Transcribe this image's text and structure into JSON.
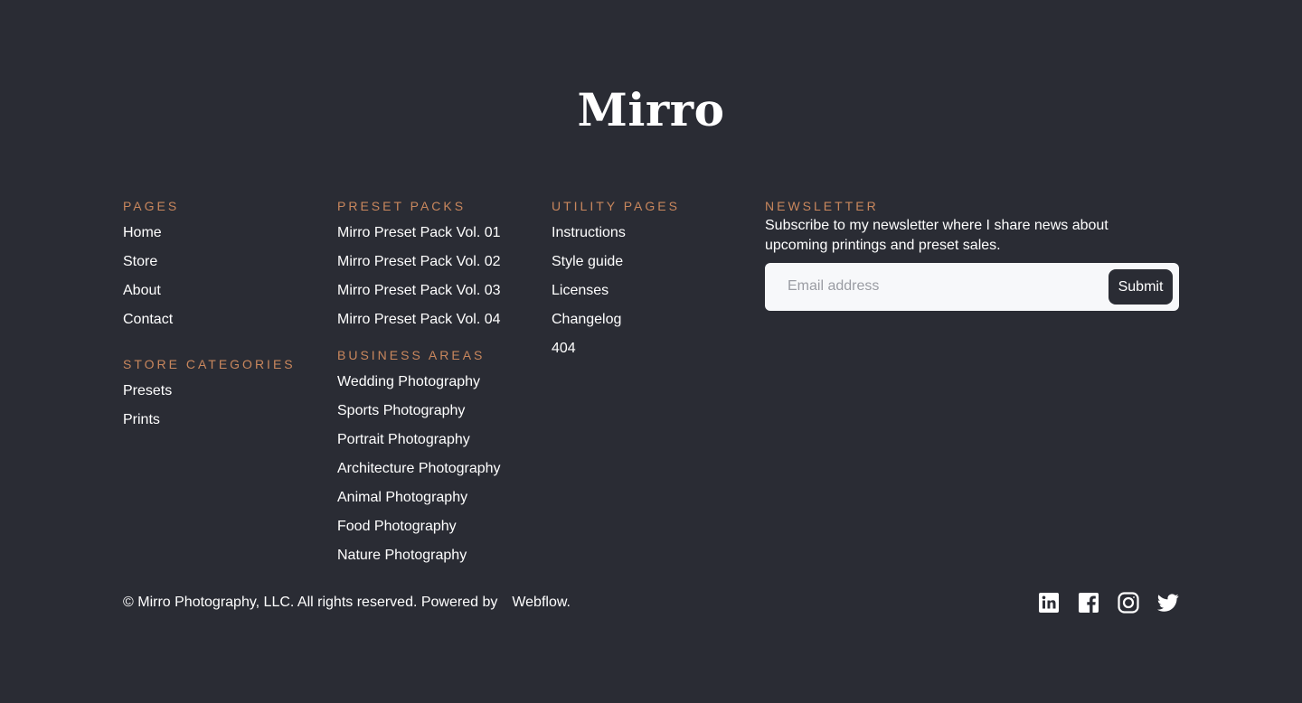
{
  "logo": {
    "text": "Mirro"
  },
  "columns": {
    "pages": {
      "heading": "Pages",
      "items": [
        "Home",
        "Store",
        "About",
        "Contact"
      ]
    },
    "store_categories": {
      "heading": "Store Categories",
      "items": [
        "Presets",
        "Prints"
      ]
    },
    "preset_packs": {
      "heading": "Preset Packs",
      "items": [
        "Mirro Preset Pack Vol. 01",
        "Mirro Preset Pack Vol. 02",
        "Mirro Preset Pack Vol. 03",
        "Mirro Preset Pack Vol. 04"
      ]
    },
    "business_areas": {
      "heading": "Business Areas",
      "items": [
        "Wedding Photography",
        "Sports Photography",
        "Portrait Photography",
        "Architecture Photography",
        "Animal Photography",
        "Food Photography",
        "Nature Photography"
      ]
    },
    "utility_pages": {
      "heading": "Utility Pages",
      "items": [
        "Instructions",
        "Style guide",
        "Licenses",
        "Changelog",
        "404"
      ]
    }
  },
  "newsletter": {
    "heading": "Newsletter",
    "text": "Subscribe to my newsletter where I share news about upcoming printings and preset sales.",
    "placeholder": "Email address",
    "submit_label": "Submit"
  },
  "bottom": {
    "copyright": "© Mirro Photography, LLC. All rights reserved. Powered by",
    "powered_link": "Webflow",
    "period": "."
  },
  "socials": [
    "linkedin-icon",
    "facebook-icon",
    "instagram-icon",
    "twitter-icon"
  ],
  "colors": {
    "background": "#2a2c34",
    "accent": "#c9875d",
    "text": "#ffffff",
    "input_bg": "#f7f8fa"
  }
}
